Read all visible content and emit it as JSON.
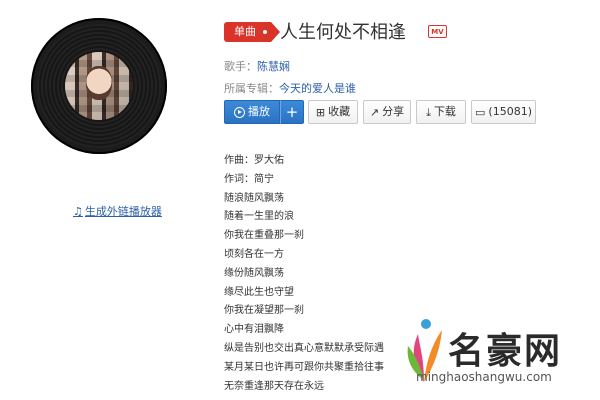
{
  "song": {
    "badge_label": "单曲",
    "title": "人生何处不相逢",
    "mv_label": "MV"
  },
  "meta": {
    "singer_label": "歌手：",
    "singer": "陈慧娴",
    "album_label": "所属专辑：",
    "album": "今天的爱人是谁"
  },
  "actions": {
    "play": "播放",
    "plus": "+",
    "collect": "收藏",
    "share": "分享",
    "download": "下载",
    "comments": "(15081)"
  },
  "sidebar": {
    "player_link": "生成外链播放器"
  },
  "lyrics": [
    "作曲：罗大佑",
    "作词：简宁",
    "随浪随风飘荡",
    "随着一生里的浪",
    "你我在重叠那一刹",
    "顷刻各在一方",
    "缘份随风飘荡",
    "缘尽此生也守望",
    "你我在凝望那一刹",
    "心中有泪飘降",
    "纵是告别也交出真心意默默承受际遇",
    "某月某日也许再可跟你共聚重拾往事",
    "无奈重逢那天存在永远"
  ],
  "watermark": {
    "name": "名豪网",
    "url": "minghaoshangwu.com"
  },
  "colors": {
    "accent_red": "#d9332a",
    "link_blue": "#2b5fa8",
    "button_blue": "#2a73c4"
  },
  "icons": {
    "play": "play-circle-icon",
    "collect": "folder-plus-icon",
    "share": "share-arrow-icon",
    "download": "download-icon",
    "comment": "comment-bubble-icon",
    "music_note": "music-note-icon"
  }
}
